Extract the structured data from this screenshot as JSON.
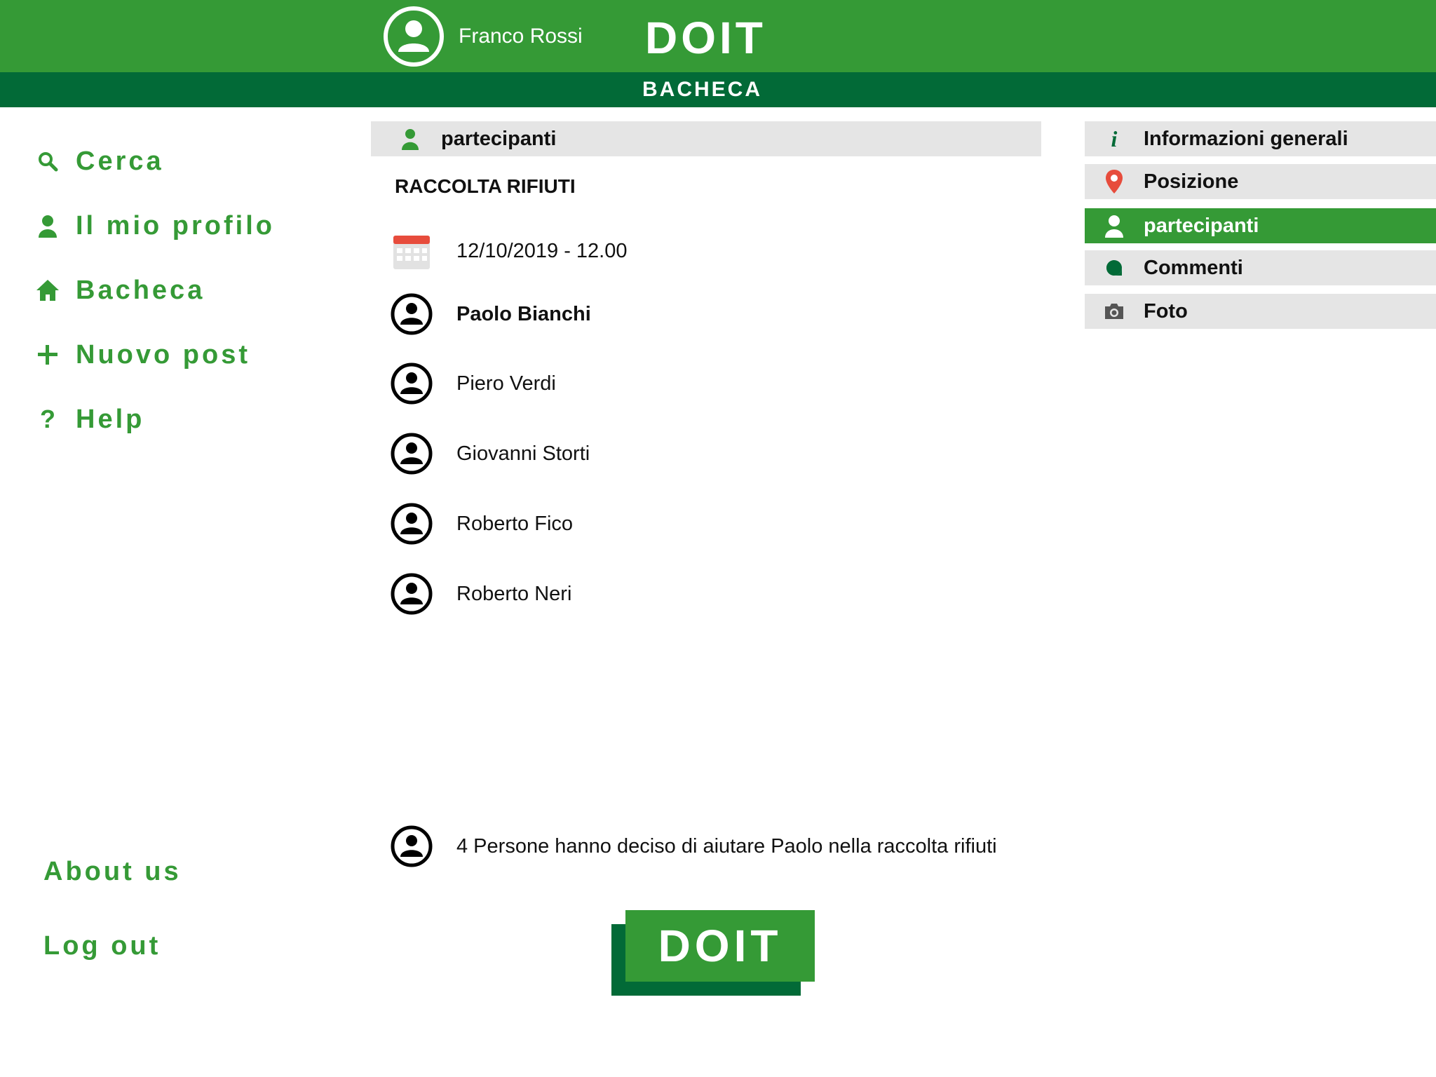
{
  "header": {
    "user_name": "Franco Rossi",
    "logo": "DOIT",
    "section_title": "BACHECA",
    "colors": {
      "primary": "#359a36",
      "dark": "#026a37"
    }
  },
  "sidebar": {
    "items": [
      {
        "icon": "search-icon",
        "label": "Cerca"
      },
      {
        "icon": "user-icon",
        "label": "Il mio profilo"
      },
      {
        "icon": "home-icon",
        "label": "Bacheca"
      },
      {
        "icon": "plus-icon",
        "label": "Nuovo post"
      },
      {
        "icon": "question-icon",
        "label": "Help"
      }
    ],
    "footer": {
      "about": "About us",
      "logout": "Log out"
    }
  },
  "main": {
    "section_header": "partecipanti",
    "event_title": "RACCOLTA RIFIUTI",
    "event_datetime": "12/10/2019 - 12.00",
    "organizer": "Paolo Bianchi",
    "participants": [
      "Piero Verdi",
      "Giovanni Storti",
      "Roberto Fico",
      "Roberto Neri"
    ],
    "summary": "4 Persone hanno deciso di aiutare Paolo nella raccolta rifiuti",
    "action_button": "DOIT"
  },
  "tabs": [
    {
      "icon": "info-icon",
      "label": "Informazioni generali",
      "active": false
    },
    {
      "icon": "location-pin-icon",
      "label": "Posizione",
      "active": false
    },
    {
      "icon": "user-icon",
      "label": "partecipanti",
      "active": true
    },
    {
      "icon": "comment-icon",
      "label": "Commenti",
      "active": false
    },
    {
      "icon": "camera-icon",
      "label": "Foto",
      "active": false
    }
  ]
}
